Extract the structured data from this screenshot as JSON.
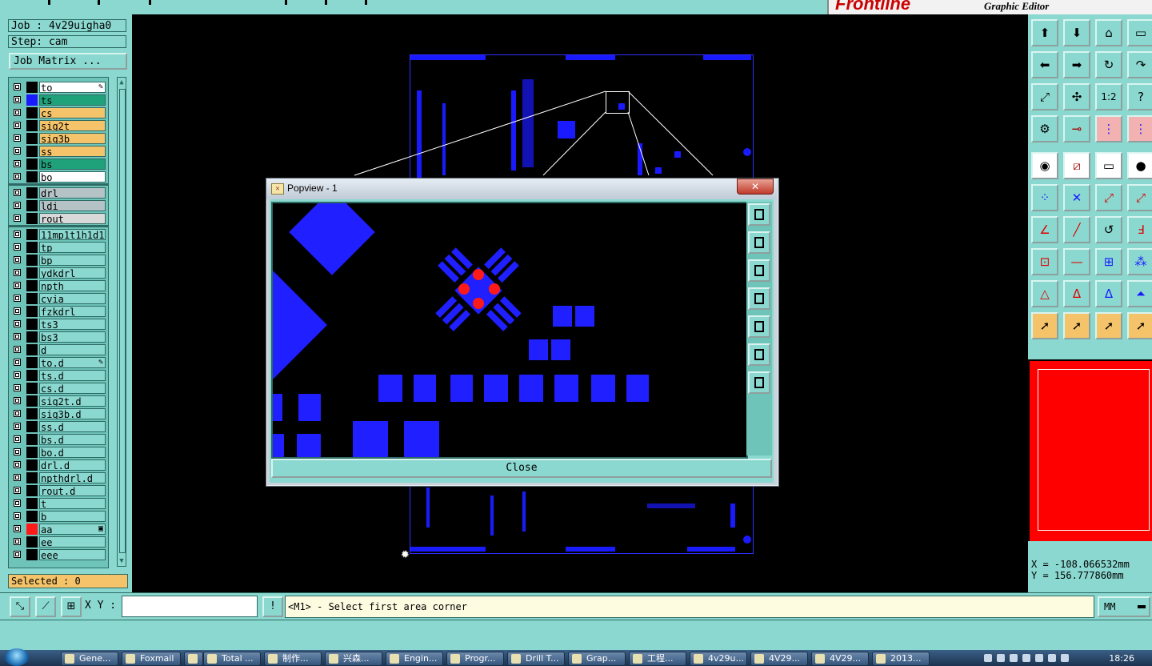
{
  "header": {
    "brand": "Frontline",
    "subtitle": "Graphic Editor"
  },
  "job": {
    "job_label": "Job : 4v29uigha0",
    "step_label": "Step: cam",
    "matrix_button": "Job Matrix ..."
  },
  "layers": [
    {
      "name": "to",
      "bg": "#ffffff",
      "swatch": "#000000",
      "mark": "✎"
    },
    {
      "name": "ts",
      "bg": "#1fa27a",
      "swatch": "#1a1aff",
      "mark": ""
    },
    {
      "name": "cs",
      "bg": "#f5c46a",
      "swatch": "#000000",
      "mark": ""
    },
    {
      "name": "sig2t",
      "bg": "#f5c46a",
      "swatch": "#000000",
      "mark": ""
    },
    {
      "name": "sig3b",
      "bg": "#f5c46a",
      "swatch": "#000000",
      "mark": ""
    },
    {
      "name": "ss",
      "bg": "#f5c46a",
      "swatch": "#000000",
      "mark": ""
    },
    {
      "name": "bs",
      "bg": "#1fa27a",
      "swatch": "#000000",
      "mark": ""
    },
    {
      "name": "bo",
      "bg": "#ffffff",
      "swatch": "#000000",
      "mark": ""
    },
    {
      "name": "drl",
      "bg": "#b5c3c6",
      "swatch": "#000000",
      "mark": ""
    },
    {
      "name": "ldi",
      "bg": "#b5c3c6",
      "swatch": "#000000",
      "mark": ""
    },
    {
      "name": "rout",
      "bg": "#d9d9d9",
      "swatch": "#000000",
      "mark": ""
    },
    {
      "name": "11mp1t1h1d1i",
      "bg": "#8ad8cf",
      "swatch": "#000000",
      "mark": ""
    },
    {
      "name": "tp",
      "bg": "#8ad8cf",
      "swatch": "#000000",
      "mark": ""
    },
    {
      "name": "bp",
      "bg": "#8ad8cf",
      "swatch": "#000000",
      "mark": ""
    },
    {
      "name": "ydkdrl",
      "bg": "#8ad8cf",
      "swatch": "#000000",
      "mark": ""
    },
    {
      "name": "npth",
      "bg": "#8ad8cf",
      "swatch": "#000000",
      "mark": ""
    },
    {
      "name": "cvia",
      "bg": "#8ad8cf",
      "swatch": "#000000",
      "mark": ""
    },
    {
      "name": "fzkdrl",
      "bg": "#8ad8cf",
      "swatch": "#000000",
      "mark": ""
    },
    {
      "name": "ts3",
      "bg": "#8ad8cf",
      "swatch": "#000000",
      "mark": ""
    },
    {
      "name": "bs3",
      "bg": "#8ad8cf",
      "swatch": "#000000",
      "mark": ""
    },
    {
      "name": "d",
      "bg": "#8ad8cf",
      "swatch": "#000000",
      "mark": ""
    },
    {
      "name": "to.d",
      "bg": "#8ad8cf",
      "swatch": "#000000",
      "mark": "✎"
    },
    {
      "name": "ts.d",
      "bg": "#8ad8cf",
      "swatch": "#000000",
      "mark": ""
    },
    {
      "name": "cs.d",
      "bg": "#8ad8cf",
      "swatch": "#000000",
      "mark": ""
    },
    {
      "name": "sig2t.d",
      "bg": "#8ad8cf",
      "swatch": "#000000",
      "mark": ""
    },
    {
      "name": "sig3b.d",
      "bg": "#8ad8cf",
      "swatch": "#000000",
      "mark": ""
    },
    {
      "name": "ss.d",
      "bg": "#8ad8cf",
      "swatch": "#000000",
      "mark": ""
    },
    {
      "name": "bs.d",
      "bg": "#8ad8cf",
      "swatch": "#000000",
      "mark": ""
    },
    {
      "name": "bo.d",
      "bg": "#8ad8cf",
      "swatch": "#000000",
      "mark": ""
    },
    {
      "name": "drl.d",
      "bg": "#8ad8cf",
      "swatch": "#000000",
      "mark": ""
    },
    {
      "name": "npthdrl.d",
      "bg": "#8ad8cf",
      "swatch": "#000000",
      "mark": ""
    },
    {
      "name": "rout.d",
      "bg": "#8ad8cf",
      "swatch": "#000000",
      "mark": ""
    },
    {
      "name": "t",
      "bg": "#8ad8cf",
      "swatch": "#000000",
      "mark": ""
    },
    {
      "name": "b",
      "bg": "#8ad8cf",
      "swatch": "#000000",
      "mark": ""
    },
    {
      "name": "aa",
      "bg": "#8ad8cf",
      "swatch": "#ff1a1a",
      "mark": "▣"
    },
    {
      "name": "ee",
      "bg": "#8ad8cf",
      "swatch": "#000000",
      "mark": ""
    },
    {
      "name": "eee",
      "bg": "#8ad8cf",
      "swatch": "#000000",
      "mark": ""
    }
  ],
  "selected_label": "Selected : 0",
  "popview": {
    "title": "Popview - 1",
    "close_label": "Close",
    "close_x": "✕"
  },
  "coords": {
    "x": "X = -108.066532mm",
    "y": "Y = 156.777860mm"
  },
  "command": {
    "xy_label": "X Y :",
    "xy_value": "",
    "message": "<M1> - Select first area corner",
    "units": "MM"
  },
  "taskbar": {
    "items": [
      "Gene...",
      "Foxmail",
      "",
      "Total ...",
      "制作...",
      "兴森...",
      "Engin...",
      "Progr...",
      "Drill T...",
      "Grap...",
      "工程...",
      "4v29u...",
      "4V29...",
      "4V29...",
      "2013..."
    ],
    "clock": "18:26"
  },
  "colors": {
    "panel": "#8ad8cf",
    "accent_blue": "#1a1aff",
    "highlight_red": "#ff1a1a",
    "orange": "#f5c46a"
  }
}
